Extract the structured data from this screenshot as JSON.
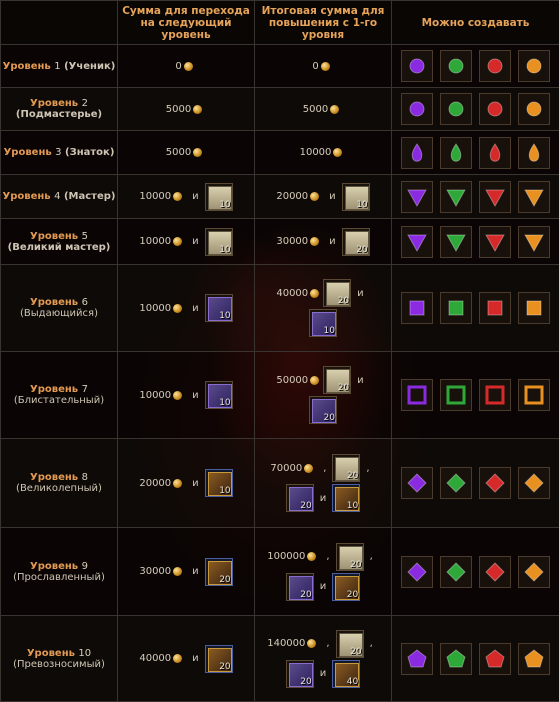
{
  "headers": {
    "col1": "",
    "col2": "Сумма для перехода на следующий уровень",
    "col3": "Итоговая сумма для повышения с 1-го уровня",
    "col4": "Можно создавать"
  },
  "conjunction_and": "и",
  "comma": ",",
  "colors": {
    "purple": "#8a2be2",
    "green": "#2fa83a",
    "red": "#d62a2a",
    "orange": "#e89020"
  },
  "rows": [
    {
      "level_word": "Уровень",
      "level_num": "1",
      "title": "(Ученик)",
      "next_amount": "0",
      "next_item": null,
      "total": {
        "amount": "0"
      }
    },
    {
      "level_word": "Уровень",
      "level_num": "2",
      "title": "(Подмастерье)",
      "next_amount": "5000",
      "next_item": null,
      "total": {
        "amount": "5000"
      }
    },
    {
      "level_word": "Уровень",
      "level_num": "3",
      "title": "(Знаток)",
      "next_amount": "5000",
      "next_item": null,
      "total": {
        "amount": "10000"
      }
    },
    {
      "level_word": "Уровень",
      "level_num": "4",
      "title": "(Мастер)",
      "next_amount": "10000",
      "next_item": {
        "icon": "scroll-icon",
        "count": "10"
      },
      "total": {
        "amount": "20000",
        "items": [
          {
            "icon": "scroll-icon",
            "count": "10"
          }
        ]
      }
    },
    {
      "level_word": "Уровень",
      "level_num": "5",
      "title": "(Великий мастер)",
      "next_amount": "10000",
      "next_item": {
        "icon": "scroll-icon",
        "count": "10"
      },
      "total": {
        "amount": "30000",
        "items": [
          {
            "icon": "scroll-icon",
            "count": "20"
          }
        ]
      }
    },
    {
      "level_word": "Уровень",
      "level_num": "6",
      "title": "(Выдающийся)",
      "next_amount": "10000",
      "next_item": {
        "icon": "tome-icon",
        "count": "10"
      },
      "total": {
        "amount": "40000",
        "items": [
          {
            "icon": "scroll-icon",
            "count": "20"
          },
          {
            "icon": "tome-icon",
            "count": "10"
          }
        ]
      }
    },
    {
      "level_word": "Уровень",
      "level_num": "7",
      "title": "(Блистательный)",
      "next_amount": "10000",
      "next_item": {
        "icon": "tome-icon",
        "count": "10"
      },
      "total": {
        "amount": "50000",
        "items": [
          {
            "icon": "scroll-icon",
            "count": "20"
          },
          {
            "icon": "tome-icon",
            "count": "20"
          }
        ]
      }
    },
    {
      "level_word": "Уровень",
      "level_num": "8",
      "title": "(Великолепный)",
      "next_amount": "20000",
      "next_item": {
        "icon": "golden-tome-icon",
        "count": "10"
      },
      "total": {
        "amount": "70000",
        "items": [
          {
            "icon": "scroll-icon",
            "count": "20"
          },
          {
            "icon": "tome-icon",
            "count": "20"
          },
          {
            "icon": "golden-tome-icon",
            "count": "10"
          }
        ]
      }
    },
    {
      "level_word": "Уровень",
      "level_num": "9",
      "title": "(Прославленный)",
      "next_amount": "30000",
      "next_item": {
        "icon": "golden-tome-icon",
        "count": "20"
      },
      "total": {
        "amount": "100000",
        "items": [
          {
            "icon": "scroll-icon",
            "count": "20"
          },
          {
            "icon": "tome-icon",
            "count": "20"
          },
          {
            "icon": "golden-tome-icon",
            "count": "20"
          }
        ]
      }
    },
    {
      "level_word": "Уровень",
      "level_num": "10",
      "title": "(Превозносимый)",
      "next_amount": "40000",
      "next_item": {
        "icon": "golden-tome-icon",
        "count": "20"
      },
      "total": {
        "amount": "140000",
        "items": [
          {
            "icon": "scroll-icon",
            "count": "20"
          },
          {
            "icon": "tome-icon",
            "count": "20"
          },
          {
            "icon": "golden-tome-icon",
            "count": "40"
          }
        ]
      }
    }
  ]
}
